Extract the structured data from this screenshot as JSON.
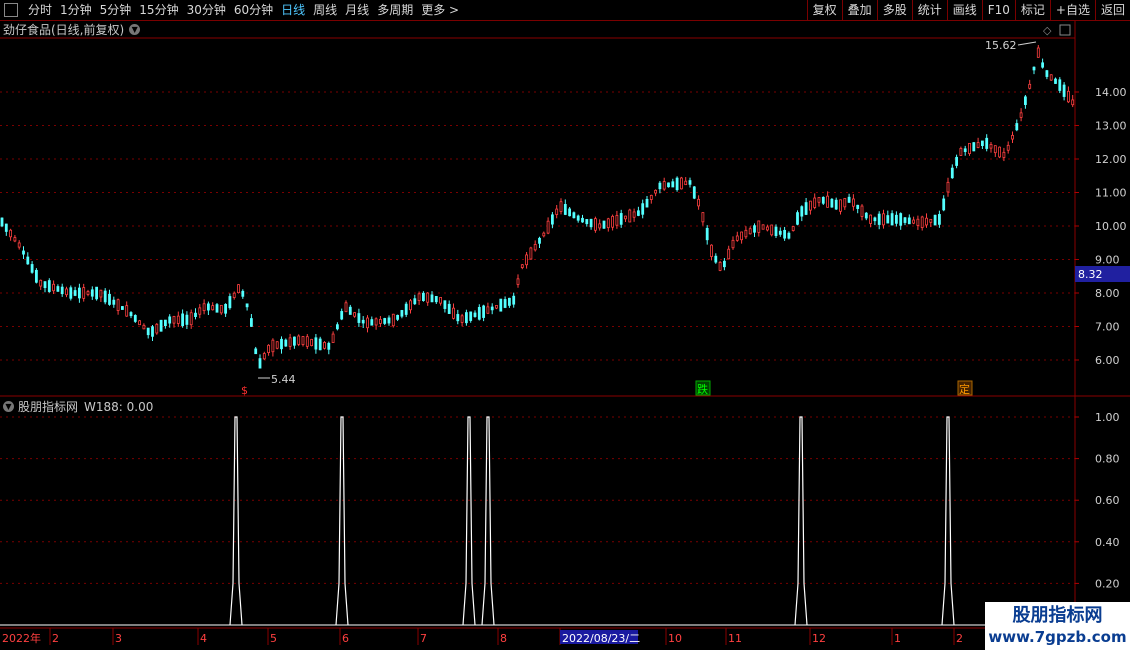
{
  "toolbar": {
    "periods": [
      {
        "label": "分时",
        "active": false
      },
      {
        "label": "1分钟",
        "active": false
      },
      {
        "label": "5分钟",
        "active": false
      },
      {
        "label": "15分钟",
        "active": false
      },
      {
        "label": "30分钟",
        "active": false
      },
      {
        "label": "60分钟",
        "active": false
      },
      {
        "label": "日线",
        "active": true
      },
      {
        "label": "周线",
        "active": false
      },
      {
        "label": "月线",
        "active": false
      },
      {
        "label": "多周期",
        "active": false
      },
      {
        "label": "更多 >",
        "active": false
      }
    ],
    "right_buttons": [
      "复权",
      "叠加",
      "多股",
      "统计",
      "画线",
      "F10",
      "标记",
      "+自选",
      "返回"
    ]
  },
  "main_panel": {
    "title": "劲仔食品(日线,前复权)",
    "price_axis": [
      "14.00",
      "13.00",
      "12.00",
      "11.00",
      "10.00",
      "9.00",
      "8.00",
      "7.00",
      "6.00"
    ],
    "current_price": "8.32",
    "high_label": "15.62",
    "low_label": "5.44",
    "markers": [
      {
        "text": "$",
        "color": "#ff3030"
      },
      {
        "text": "跌",
        "color": "#00cc00"
      },
      {
        "text": "定",
        "color": "#ff8800"
      }
    ]
  },
  "sub_panel": {
    "title": "股朋指标网",
    "indicator_label": "W188: 0.00",
    "axis": [
      "1.00",
      "0.80",
      "0.60",
      "0.40",
      "0.20"
    ],
    "spikes_months": [
      "4",
      "5",
      "7",
      "8",
      "11",
      "2"
    ]
  },
  "date_axis": {
    "labels": [
      "2022年",
      "2",
      "3",
      "4",
      "5",
      "6",
      "7",
      "8",
      "2022/08/23/二",
      "10",
      "11",
      "12",
      "1",
      "2"
    ]
  },
  "watermark": {
    "line1": "股朋指标网",
    "line2": "www.7gpzb.com"
  },
  "colors": {
    "up": "#ff4040",
    "down": "#54ffff",
    "grid": "#8a0000",
    "spike": "#ffffff"
  }
}
